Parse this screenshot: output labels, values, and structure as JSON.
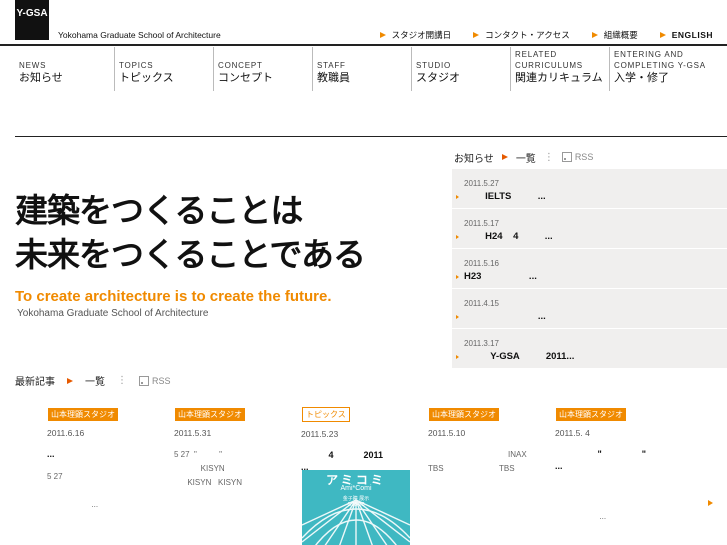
{
  "header": {
    "logo_text": "Y-GSA",
    "site_title": "Yokohama Graduate School of Architecture",
    "utility": [
      {
        "label": "スタジオ開講日"
      },
      {
        "label": "コンタクト・アクセス"
      },
      {
        "label": "組織概要"
      },
      {
        "label": "ENGLISH"
      }
    ]
  },
  "nav": [
    {
      "en": "NEWS",
      "ja": "お知らせ"
    },
    {
      "en": "TOPICS",
      "ja": "トピックス"
    },
    {
      "en": "CONCEPT",
      "ja": "コンセプト"
    },
    {
      "en": "STAFF",
      "ja": "教職員"
    },
    {
      "en": "STUDIO",
      "ja": "スタジオ"
    },
    {
      "en1": "RELATED",
      "en2": "CURRICULUMS",
      "ja": "関連カリキュラム"
    },
    {
      "en1": "ENTERING AND",
      "en2": "COMPLETING Y-GSA",
      "ja": "入学・修了"
    }
  ],
  "hero": {
    "line1": "建築をつくることは",
    "line2": "未来をつくることである",
    "english": "To create architecture is to create the future.",
    "school": "Yokohama Graduate School of Architecture"
  },
  "news": {
    "heading": "お知らせ",
    "list_label": "一覧",
    "rss_label": "RSS",
    "items": [
      {
        "date": "2011.5.27",
        "title": "        IELTS          ..."
      },
      {
        "date": "2011.5.17",
        "title": "        H24    4          ..."
      },
      {
        "date": "2011.5.16",
        "title": "H23                  ..."
      },
      {
        "date": "2011.4.15",
        "title": "                            ..."
      },
      {
        "date": "2011.3.17",
        "title": "          Y-GSA          2011..."
      }
    ]
  },
  "latest": {
    "heading": "最新記事",
    "list_label": "一覧",
    "rss_label": "RSS",
    "articles": [
      {
        "tag": "山本理顕スタジオ",
        "date": "2011.6.16",
        "title": "...",
        "body": "5 27\n\n                    ..."
      },
      {
        "tag": "山本理顕スタジオ",
        "date": "2011.5.31",
        "title": "",
        "body": "5 27  \"          \"\n            KISYN\n      KISYN   KISYN"
      },
      {
        "tag": "トピックス",
        "date": "2011.5.23",
        "title": "           4            2011\n...",
        "body": ""
      },
      {
        "tag": "山本理顕スタジオ",
        "date": "2011.5.10",
        "title": "",
        "body": "                                    INAX\nTBS                         TBS"
      },
      {
        "tag": "山本理顕スタジオ",
        "date": "2011.5. 4",
        "title": "                 \"                \"\n...",
        "body": "\n\n                    ..."
      }
    ],
    "thumb": {
      "title": "アミコミ",
      "subtitle": "Ami*Comi",
      "small1": "金子瞳 展示",
      "small2": "6/25-28"
    }
  }
}
